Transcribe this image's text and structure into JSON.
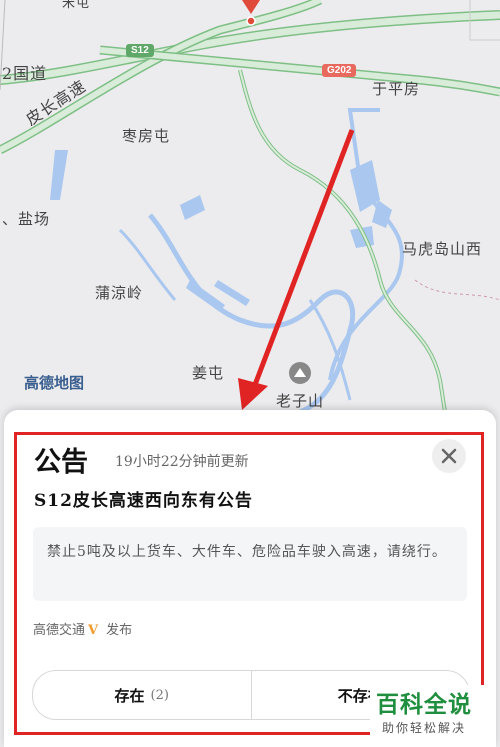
{
  "map": {
    "labels": {
      "road_s12": "S12",
      "road_g202": "G202",
      "expressway_left": "2国道",
      "expressway_name": "皮长高速",
      "zaofangtun": "枣房屯",
      "yuping": "于平房",
      "yanchang": "、盐场",
      "mahudao": "马虎岛山西",
      "puliangling": "蒲涼岭",
      "jiangtun": "姜屯",
      "laozishan": "老子山",
      "top_partial": "米屯"
    },
    "logo": "高德地图",
    "colors": {
      "road": "#cfe6d0",
      "road_edge": "#7fbf86",
      "water": "#a9c7ef",
      "land": "#ececee"
    }
  },
  "notice": {
    "title": "公告",
    "updated": "19小时22分钟前更新",
    "subtitle": "S12皮长高速西向东有公告",
    "body": "禁止5吨及以上货车、大件车、危险品车驶入高速，请绕行。",
    "publisher": "高德交通",
    "publish_action": "发布",
    "close_icon": "close-icon",
    "buttons": {
      "exists_label": "存在",
      "exists_count": "(2)",
      "not_exists_label": "不存在"
    }
  },
  "watermark": {
    "title": "百科全说",
    "subtitle": "助你轻松解决"
  },
  "colors": {
    "highlight_border": "#e02424",
    "arrow": "#e02424",
    "accent": "#f39a2b"
  }
}
